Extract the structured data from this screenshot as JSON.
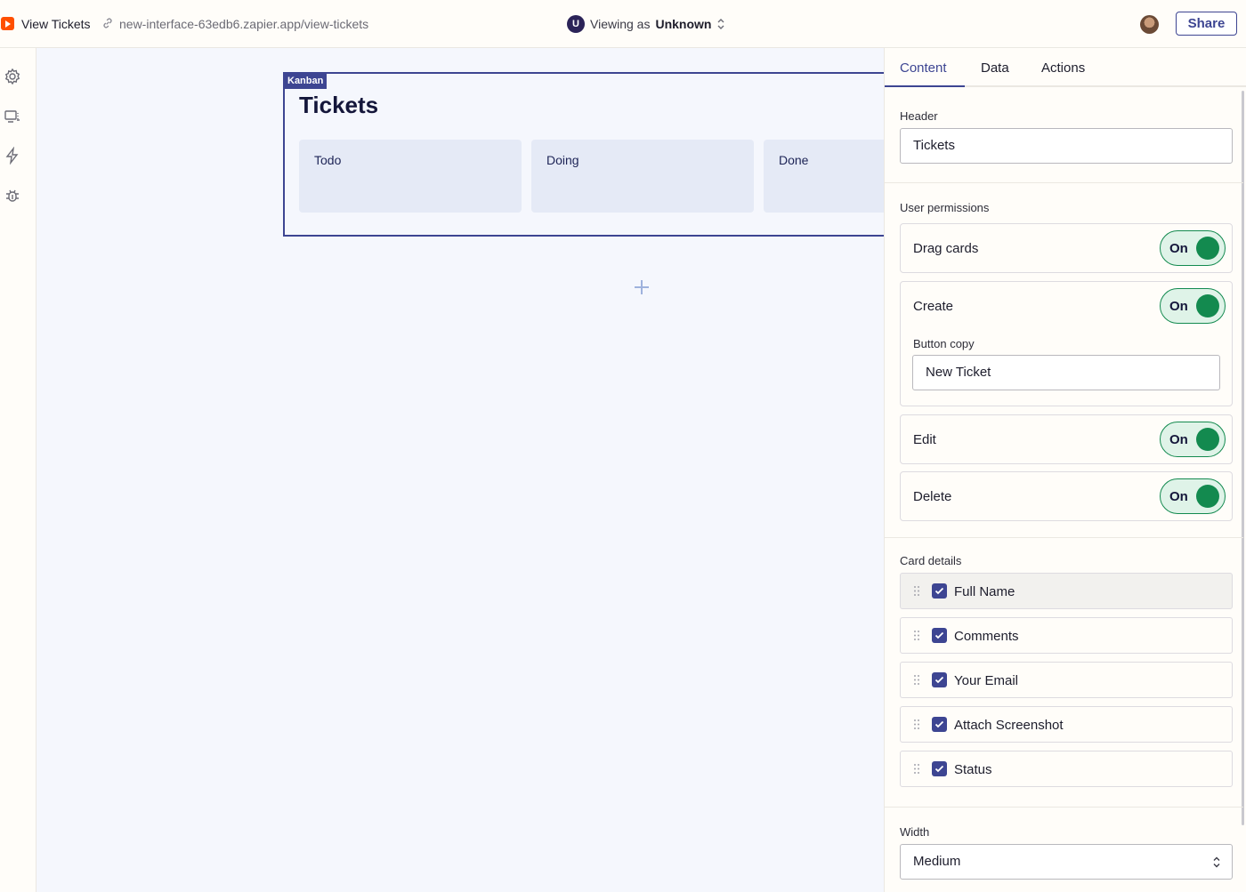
{
  "topbar": {
    "app_title": "View Tickets",
    "url": "new-interface-63edb6.zapier.app/view-tickets",
    "viewer_badge": "U",
    "viewing_prefix": "Viewing as",
    "viewing_user": "Unknown",
    "share_label": "Share"
  },
  "rail": {
    "icons": [
      "gear-icon",
      "display-icon",
      "lightning-icon",
      "bug-icon"
    ]
  },
  "canvas": {
    "block_tag": "Kanban",
    "kanban_title": "Tickets",
    "columns": [
      "Todo",
      "Doing",
      "Done"
    ]
  },
  "panel": {
    "tabs": [
      "Content",
      "Data",
      "Actions"
    ],
    "active_tab": "Content",
    "header_label": "Header",
    "header_value": "Tickets",
    "permissions_label": "User permissions",
    "permissions": [
      {
        "label": "Drag cards",
        "state": "On"
      },
      {
        "label": "Create",
        "state": "On"
      },
      {
        "label": "Edit",
        "state": "On"
      },
      {
        "label": "Delete",
        "state": "On"
      }
    ],
    "button_copy_label": "Button copy",
    "button_copy_value": "New Ticket",
    "card_details_label": "Card details",
    "card_fields": [
      "Full Name",
      "Comments",
      "Your Email",
      "Attach Screenshot",
      "Status"
    ],
    "width_label": "Width",
    "width_value": "Medium"
  },
  "colors": {
    "accent": "#3d4592",
    "toggle_on": "#138a4f",
    "brand": "#ff4f00"
  }
}
